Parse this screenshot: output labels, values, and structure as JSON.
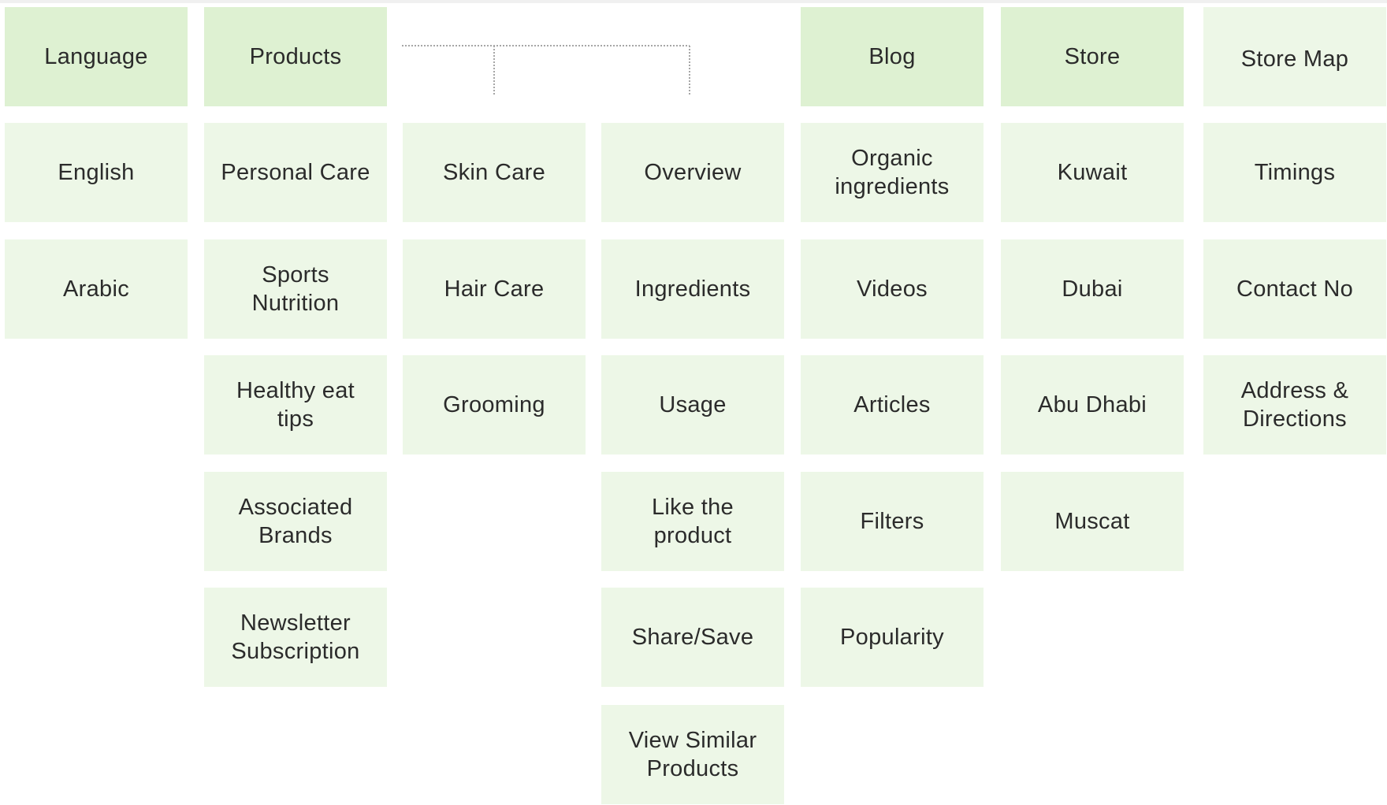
{
  "diagram": {
    "colors": {
      "header_bg": "#DEF1D2",
      "item_bg": "#EDF7E7",
      "text": "#2B2B2B",
      "connector": "#A6A6A6"
    },
    "columns": [
      {
        "id": "language",
        "header": "Language",
        "items": [
          "English",
          "Arabic"
        ]
      },
      {
        "id": "products",
        "header": "Products",
        "items": [
          "Personal Care",
          "Sports Nutrition",
          "Healthy eat tips",
          "Associated Brands",
          "Newsletter Subscription"
        ]
      },
      {
        "id": "product-categories",
        "header": null,
        "items": [
          "Skin Care",
          "Hair Care",
          "Grooming"
        ]
      },
      {
        "id": "product-details",
        "header": null,
        "items": [
          "Overview",
          "Ingredients",
          "Usage",
          "Like the product",
          "Share/Save",
          "View Similar Products"
        ]
      },
      {
        "id": "blog",
        "header": "Blog",
        "items": [
          "Organic ingredients",
          "Videos",
          "Articles",
          "Filters",
          "Popularity"
        ]
      },
      {
        "id": "store",
        "header": "Store",
        "items": [
          "Kuwait",
          "Dubai",
          "Abu Dhabi",
          "Muscat"
        ]
      },
      {
        "id": "store-map",
        "header": "Store Map",
        "items": [
          "Timings",
          "Contact No",
          "Address & Directions"
        ]
      }
    ]
  }
}
